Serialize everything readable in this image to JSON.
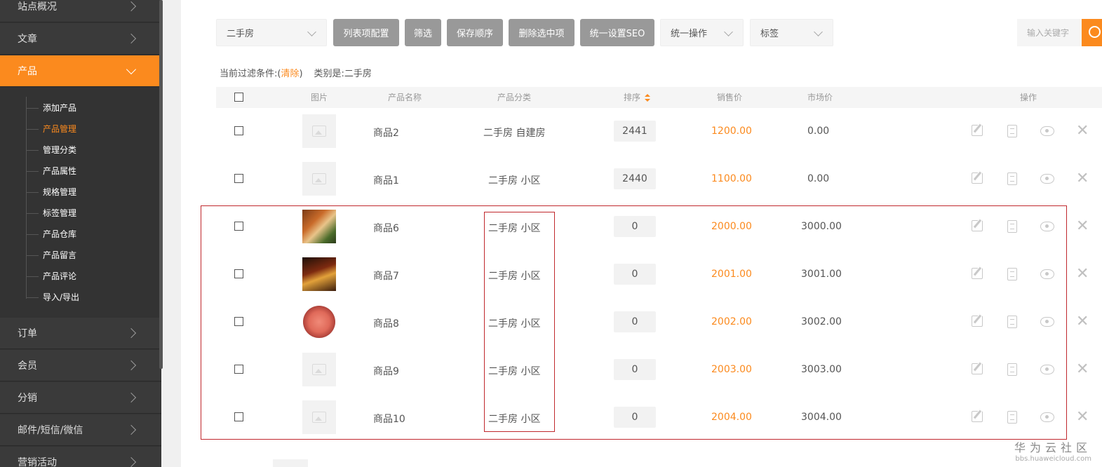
{
  "sidebar": {
    "items": [
      {
        "label": "站点概况"
      },
      {
        "label": "文章"
      },
      {
        "label": "产品"
      },
      {
        "label": "订单"
      },
      {
        "label": "会员"
      },
      {
        "label": "分销"
      },
      {
        "label": "邮件/短信/微信"
      },
      {
        "label": "营销活动"
      }
    ],
    "subitems": [
      {
        "label": "添加产品"
      },
      {
        "label": "产品管理"
      },
      {
        "label": "管理分类"
      },
      {
        "label": "产品属性"
      },
      {
        "label": "规格管理"
      },
      {
        "label": "标签管理"
      },
      {
        "label": "产品仓库"
      },
      {
        "label": "产品留言"
      },
      {
        "label": "产品评论"
      },
      {
        "label": "导入/导出"
      }
    ]
  },
  "toolbar": {
    "category_select": "二手房",
    "buttons": [
      "列表项配置",
      "筛选",
      "保存顺序",
      "删除选中项",
      "统一设置SEO"
    ],
    "batch_select": "统一操作",
    "tag_select": "标签",
    "search_placeholder": "输入关键字"
  },
  "filter": {
    "prefix": "当前过滤条件:(",
    "clear": "清除",
    "suffix": ")",
    "category": "类别是:二手房"
  },
  "table": {
    "headers": {
      "image": "图片",
      "name": "产品名称",
      "category": "产品分类",
      "sort": "排序",
      "price": "销售价",
      "market": "市场价",
      "actions": "操作"
    },
    "rows": [
      {
        "name": "商品2",
        "category": "二手房 自建房",
        "sort": "2441",
        "price": "1200.00",
        "market": "0.00",
        "image": "placeholder"
      },
      {
        "name": "商品1",
        "category": "二手房 小区",
        "sort": "2440",
        "price": "1100.00",
        "market": "0.00",
        "image": "placeholder"
      },
      {
        "name": "商品6",
        "category": "二手房 小区",
        "sort": "0",
        "price": "2000.00",
        "market": "3000.00",
        "image": "food-photo"
      },
      {
        "name": "商品7",
        "category": "二手房 小区",
        "sort": "0",
        "price": "2001.00",
        "market": "3001.00",
        "image": "food-photo"
      },
      {
        "name": "商品8",
        "category": "二手房 小区",
        "sort": "0",
        "price": "2002.00",
        "market": "3002.00",
        "image": "meat-photo"
      },
      {
        "name": "商品9",
        "category": "二手房 小区",
        "sort": "0",
        "price": "2003.00",
        "market": "3003.00",
        "image": "placeholder"
      },
      {
        "name": "商品10",
        "category": "二手房 小区",
        "sort": "0",
        "price": "2004.00",
        "market": "3004.00",
        "image": "placeholder"
      }
    ]
  },
  "watermark": {
    "title": "华为云社区",
    "url": "bbs.huaweicloud.com"
  },
  "colors": {
    "accent": "#fb8a1e",
    "sidebar_bg": "#333333",
    "button_bg": "#999999",
    "highlight_border": "#c0282d"
  }
}
